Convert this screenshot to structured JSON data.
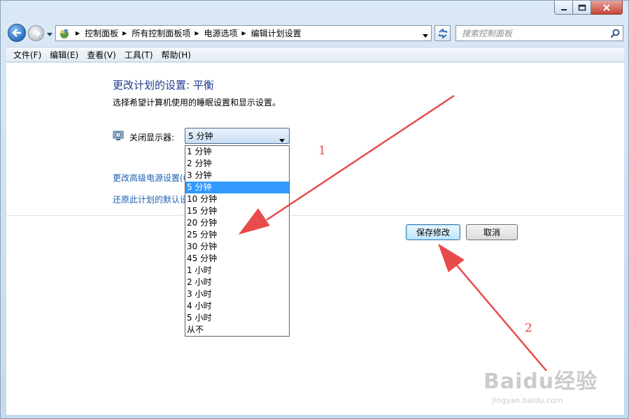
{
  "window": {
    "breadcrumb": [
      "控制面板",
      "所有控制面板项",
      "电源选项",
      "编辑计划设置"
    ],
    "search_placeholder": "搜索控制面板"
  },
  "menu": [
    "文件(F)",
    "编辑(E)",
    "查看(V)",
    "工具(T)",
    "帮助(H)"
  ],
  "page": {
    "title": "更改计划的设置: 平衡",
    "subtitle": "选择希望计算机使用的睡眠设置和显示设置。",
    "display_label": "关闭显示器:",
    "selected_value": "5 分钟",
    "link_advanced": "更改高级电源设置(C)",
    "link_restore": "还原此计划的默认设置(R)"
  },
  "buttons": {
    "save": "保存修改",
    "cancel": "取消"
  },
  "dropdown_options": [
    "1 分钟",
    "2 分钟",
    "3 分钟",
    "5 分钟",
    "10 分钟",
    "15 分钟",
    "20 分钟",
    "25 分钟",
    "30 分钟",
    "45 分钟",
    "1 小时",
    "2 小时",
    "3 小时",
    "4 小时",
    "5 小时",
    "从不"
  ],
  "selected_index": 3,
  "annotations": {
    "label1": "1",
    "label2": "2"
  },
  "watermark": {
    "logo": "Baidu经验",
    "url": "jingyan.baidu.com"
  },
  "colors": {
    "accent": "#1e3a8c",
    "link": "#1a5fb4",
    "highlight": "#3399ff",
    "annotation": "#e84b4b"
  }
}
